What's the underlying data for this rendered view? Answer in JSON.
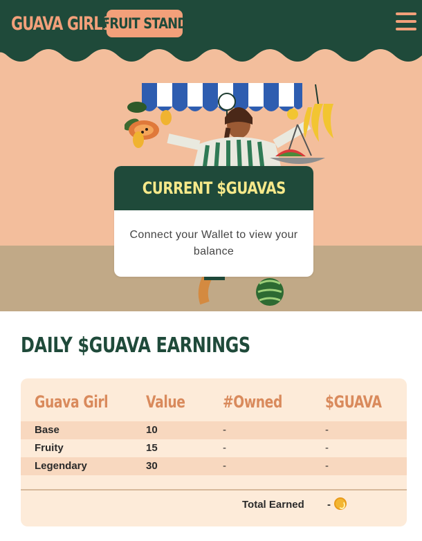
{
  "header": {
    "logo_part1": "GUAVA GIRLS",
    "logo_part2": "FRUIT STAND",
    "menu_icon": "hamburger-menu-icon"
  },
  "colors": {
    "header_green": "#1f4a3a",
    "peach": "#f3be9c",
    "ground": "#c1a987",
    "accent_orange": "#d98a5c",
    "title_yellow": "#f7e98a",
    "table_bg": "#fdebd9",
    "row_stripe": "#f8d8bf"
  },
  "balance": {
    "title": "CURRENT $GUAVAS",
    "message": "Connect your Wallet to view your balance"
  },
  "earnings": {
    "title": "DAILY $GUAVA EARNINGS",
    "columns": [
      "Guava Girl",
      "Value",
      "#Owned",
      "$GUAVA"
    ],
    "rows": [
      {
        "name": "Base",
        "value": "10",
        "owned": "-",
        "guava": "-"
      },
      {
        "name": "Fruity",
        "value": "15",
        "owned": "-",
        "guava": "-"
      },
      {
        "name": "Legendary",
        "value": "30",
        "owned": "-",
        "guava": "-"
      }
    ],
    "total_label": "Total Earned",
    "total_value": "-",
    "total_icon": "guava-coin-icon"
  }
}
